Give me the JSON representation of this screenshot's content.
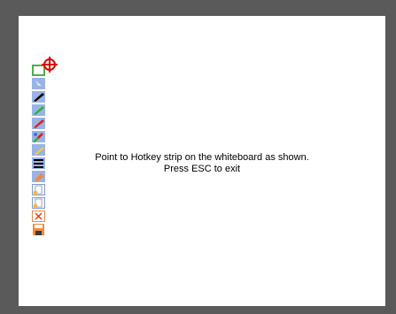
{
  "message": {
    "line1": "Point to Hotkey strip on the whiteboard as shown.",
    "line2": "Press ESC to exit"
  },
  "hotkeys": [
    {
      "name": "select-area-icon",
      "color": "#4caf50"
    },
    {
      "name": "pointer-icon",
      "color": "#9ab3e6"
    },
    {
      "name": "black-pen-icon",
      "color": "#000000"
    },
    {
      "name": "green-pen-icon",
      "color": "#2db52d"
    },
    {
      "name": "red-pen-icon",
      "color": "#e02020"
    },
    {
      "name": "multicolor-pen-icon",
      "color": "#3a7adf"
    },
    {
      "name": "highlighter-icon",
      "color": "#f2c94c"
    },
    {
      "name": "line-width-icon",
      "color": "#000000"
    },
    {
      "name": "eraser-icon",
      "color": "#f08a3c"
    },
    {
      "name": "new-page-icon",
      "color": "#ffffff"
    },
    {
      "name": "page-icon",
      "color": "#ffffff"
    },
    {
      "name": "clear-page-icon",
      "color": "#e04020"
    },
    {
      "name": "save-icon",
      "color": "#f08a3c"
    }
  ],
  "colors": {
    "frame": "#5a5a5a",
    "board": "#ffffff",
    "target": "#e00000"
  }
}
